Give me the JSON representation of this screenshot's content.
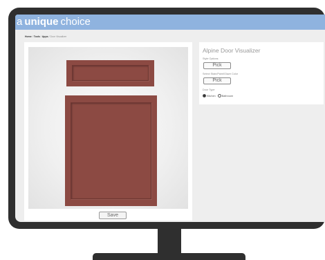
{
  "header": {
    "brand_word1": "a",
    "brand_word2": "unique",
    "brand_word3": "choice",
    "bg_color": "#8fb3df"
  },
  "breadcrumb": {
    "items": [
      "Home",
      "Tools",
      "Apps",
      "Door Visualizer"
    ],
    "separator": "/"
  },
  "visualizer": {
    "door_color": "#8c4a43",
    "save_label": "Save"
  },
  "options": {
    "title": "Alpine Door Visualizer",
    "style_label": "Style Options",
    "style_pick_label": "Pick",
    "finish_label": "Select Stain/Paint/Glaze Color",
    "finish_pick_label": "Pick",
    "type_label": "Door Type",
    "radio_options": [
      {
        "label": "Kitchen",
        "selected": true
      },
      {
        "label": "Bathroom",
        "selected": false
      }
    ]
  }
}
